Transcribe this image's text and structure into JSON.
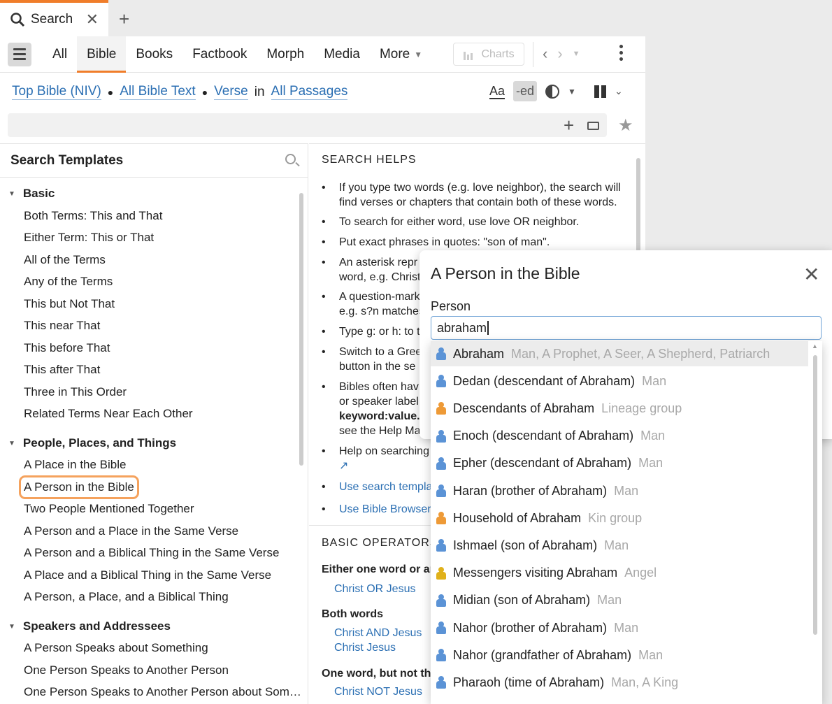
{
  "tabstrip": {
    "tab_label": "Search",
    "close": "✕",
    "new_tab": "+"
  },
  "toolbar": {
    "tabs": [
      "All",
      "Bible",
      "Books",
      "Factbook",
      "Morph",
      "Media",
      "More"
    ],
    "active_tab": "Bible",
    "charts_label": "Charts"
  },
  "scope": {
    "bible": "Top Bible (NIV)",
    "text": "All Bible Text",
    "unit": "Verse",
    "in": "in",
    "range": "All Passages"
  },
  "tools": {
    "aa": "Aa",
    "ed": "-ed"
  },
  "templates": {
    "title": "Search Templates",
    "groups": [
      {
        "label": "Basic",
        "items": [
          "Both Terms: This and That",
          "Either Term: This or That",
          "All of the Terms",
          "Any of the Terms",
          "This but Not That",
          "This near That",
          "This before That",
          "This after That",
          "Three in This Order",
          "Related Terms Near Each Other"
        ]
      },
      {
        "label": "People, Places, and Things",
        "items": [
          "A Place in the Bible",
          "A Person in the Bible",
          "Two People Mentioned Together",
          "A Person and a Place in the Same Verse",
          "A Person and a Biblical Thing in the Same Verse",
          "A Place and a Biblical Thing in the Same Verse",
          "A Person, a Place, and a Biblical Thing"
        ]
      },
      {
        "label": "Speakers and Addressees",
        "items": [
          "A Person Speaks about Something",
          "One Person Speaks to Another Person",
          "One Person Speaks to Another Person about Som…"
        ]
      }
    ]
  },
  "helps": {
    "title": "SEARCH HELPS",
    "items": [
      "If you type two words (e.g. love neighbor), the search will",
      "find verses or chapters that contain both of these words.",
      "To search for either word, use love OR neighbor.",
      "Put exact phrases in quotes: \"son of man\".",
      "An asterisk repr",
      "word, e.g. Christ",
      "A question-mark",
      "e.g. s?n matches",
      "Type g: or h: to t",
      "Switch to a Gree",
      "button in the se",
      "Bibles often hav",
      "or speaker label",
      "keyword:value.",
      "see the Help Ma",
      "Help on searching",
      "Use search templa",
      "Use Bible Browser"
    ],
    "operators_title": "BASIC OPERATORS",
    "operators": [
      {
        "title": "Either one word or an",
        "examples": [
          "Christ OR Jesus"
        ]
      },
      {
        "title": "Both words",
        "examples": [
          "Christ AND Jesus",
          "Christ Jesus"
        ]
      },
      {
        "title": "One word, but not th",
        "examples": [
          "Christ NOT Jesus"
        ]
      }
    ]
  },
  "popup": {
    "title": "A Person in the Bible",
    "field_label": "Person",
    "input_value": "abraham",
    "close": "✕"
  },
  "autocomplete": [
    {
      "name": "Abraham",
      "type": "Man, A Prophet, A Seer, A Shepherd, Patriarch",
      "icon": "man"
    },
    {
      "name": "Dedan (descendant of Abraham)",
      "type": "Man",
      "icon": "man"
    },
    {
      "name": "Descendants of Abraham",
      "type": "Lineage group",
      "icon": "group"
    },
    {
      "name": "Enoch (descendant of Abraham)",
      "type": "Man",
      "icon": "man"
    },
    {
      "name": "Epher (descendant of Abraham)",
      "type": "Man",
      "icon": "man"
    },
    {
      "name": "Haran (brother of Abraham)",
      "type": "Man",
      "icon": "man"
    },
    {
      "name": "Household of Abraham",
      "type": "Kin group",
      "icon": "group"
    },
    {
      "name": "Ishmael (son of Abraham)",
      "type": "Man",
      "icon": "man"
    },
    {
      "name": "Messengers visiting Abraham",
      "type": "Angel",
      "icon": "angel"
    },
    {
      "name": "Midian (son of Abraham)",
      "type": "Man",
      "icon": "man"
    },
    {
      "name": "Nahor (brother of Abraham)",
      "type": "Man",
      "icon": "man"
    },
    {
      "name": "Nahor (grandfather of Abraham)",
      "type": "Man",
      "icon": "man"
    },
    {
      "name": "Pharaoh (time of Abraham)",
      "type": "Man, A King",
      "icon": "man"
    }
  ],
  "colors": {
    "accent": "#f07d2a",
    "link": "#2b6fb3",
    "man": "#5b93d6",
    "group": "#ee9a37",
    "angel": "#e0b11b"
  }
}
